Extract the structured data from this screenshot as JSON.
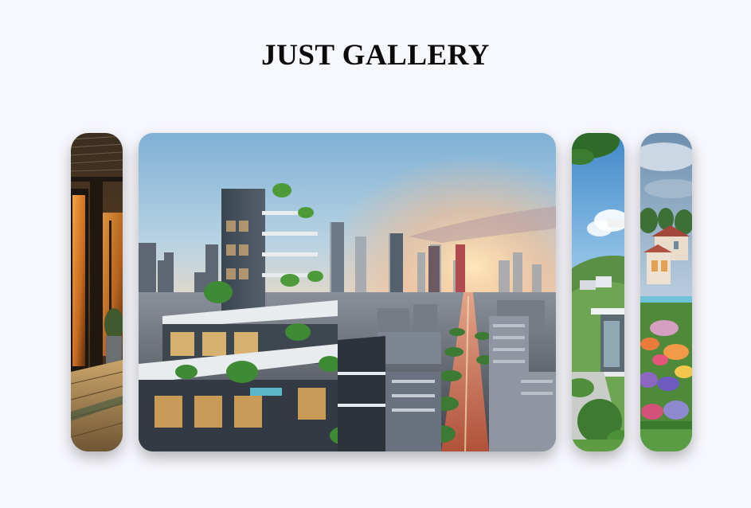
{
  "page": {
    "title": "JUST GALLERY"
  },
  "gallery": {
    "items": [
      {
        "image": "balcony-interior-sunset-image",
        "expanded": false
      },
      {
        "image": "green-terrace-skyscraper-city-image",
        "expanded": true
      },
      {
        "image": "hillside-modern-house-image",
        "expanded": false
      },
      {
        "image": "villa-flower-garden-image",
        "expanded": false
      }
    ]
  },
  "colors": {
    "background": "#f7f8fd",
    "title": "#0a0a0a"
  }
}
